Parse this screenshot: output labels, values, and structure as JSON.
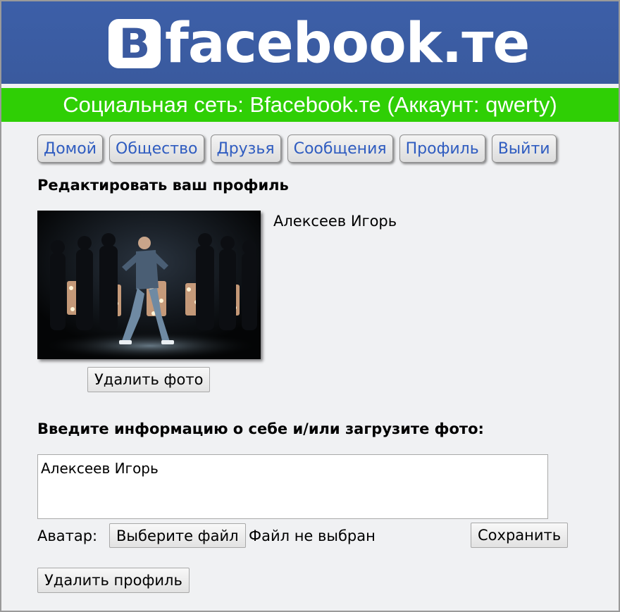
{
  "logo": {
    "box_letter": "B",
    "text": "facebook.те"
  },
  "title_bar": {
    "text": "Социальная сеть: Bfacebook.те (Аккаунт: qwerty)"
  },
  "nav": {
    "items": [
      {
        "label": "Домой"
      },
      {
        "label": "Общество"
      },
      {
        "label": "Друзья"
      },
      {
        "label": "Сообщения"
      },
      {
        "label": "Профиль"
      },
      {
        "label": "Выйти"
      }
    ]
  },
  "profile": {
    "heading": "Редактировать ваш профиль",
    "name": "Алексеев Игорь",
    "delete_photo_label": "Удалить фото"
  },
  "form": {
    "heading": "Введите информацию о себе и/или загрузите фото:",
    "about_value": "Алексеев Игорь",
    "avatar_label": "Аватар:",
    "choose_file_label": "Выберите файл",
    "no_file_text": "Файл не выбран",
    "save_label": "Сохранить",
    "delete_profile_label": "Удалить профиль"
  },
  "colors": {
    "logo_bg": "#3b5aa0",
    "title_bar_bg": "#2fcf05",
    "nav_link": "#2f5cc0",
    "page_bg": "#f0f1f3"
  }
}
